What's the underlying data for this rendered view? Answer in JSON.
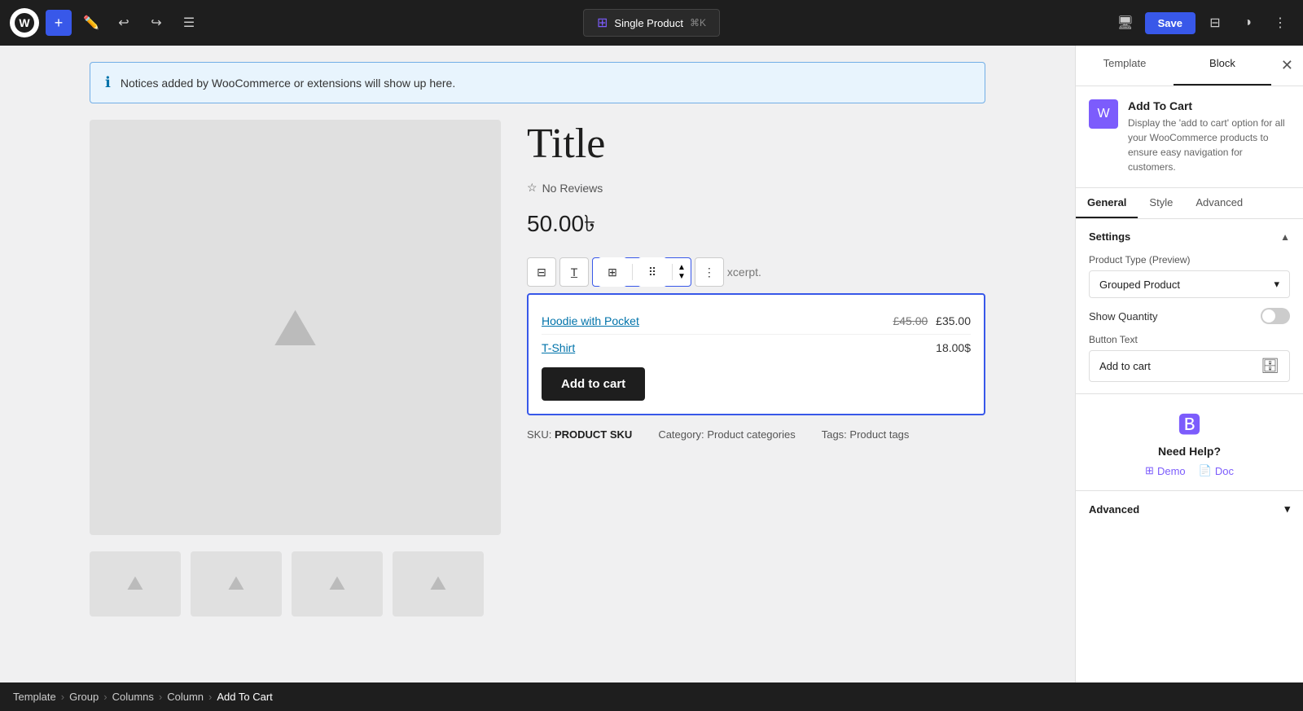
{
  "topbar": {
    "save_label": "Save",
    "template_label": "Single Product",
    "keyboard_shortcut": "⌘K"
  },
  "notice": {
    "text": "Notices added by WooCommerce or extensions will show up here."
  },
  "product": {
    "title": "Title",
    "reviews": "No Reviews",
    "price": "50.00৳",
    "excerpt": "xcerpt.",
    "grouped_items": [
      {
        "name": "Hoodie with Pocket",
        "old_price": "£45.00",
        "new_price": "£35.00"
      },
      {
        "name": "T-Shirt",
        "price": "18.00$"
      }
    ],
    "add_to_cart_label": "Add to cart",
    "sku_label": "SKU:",
    "sku_value": "PRODUCT SKU",
    "category_label": "Category:",
    "category_value": "Product categories",
    "tags_label": "Tags:",
    "tags_value": "Product tags"
  },
  "right_panel": {
    "tab_template": "Template",
    "tab_block": "Block",
    "block_title": "Add To Cart",
    "block_description": "Display the 'add to cart' option for all your WooCommerce products to ensure easy navigation for customers.",
    "settings_tabs": {
      "general": "General",
      "style": "Style",
      "advanced": "Advanced"
    },
    "settings_section_title": "Settings",
    "product_type_label": "Product Type (Preview)",
    "product_type_value": "Grouped Product",
    "show_quantity_label": "Show Quantity",
    "button_text_label": "Button Text",
    "button_text_value": "Add to cart",
    "need_help_title": "Need Help?",
    "demo_label": "Demo",
    "doc_label": "Doc",
    "advanced_label": "Advanced"
  },
  "breadcrumb": {
    "items": [
      "Template",
      "Group",
      "Columns",
      "Column",
      "Add To Cart"
    ]
  }
}
